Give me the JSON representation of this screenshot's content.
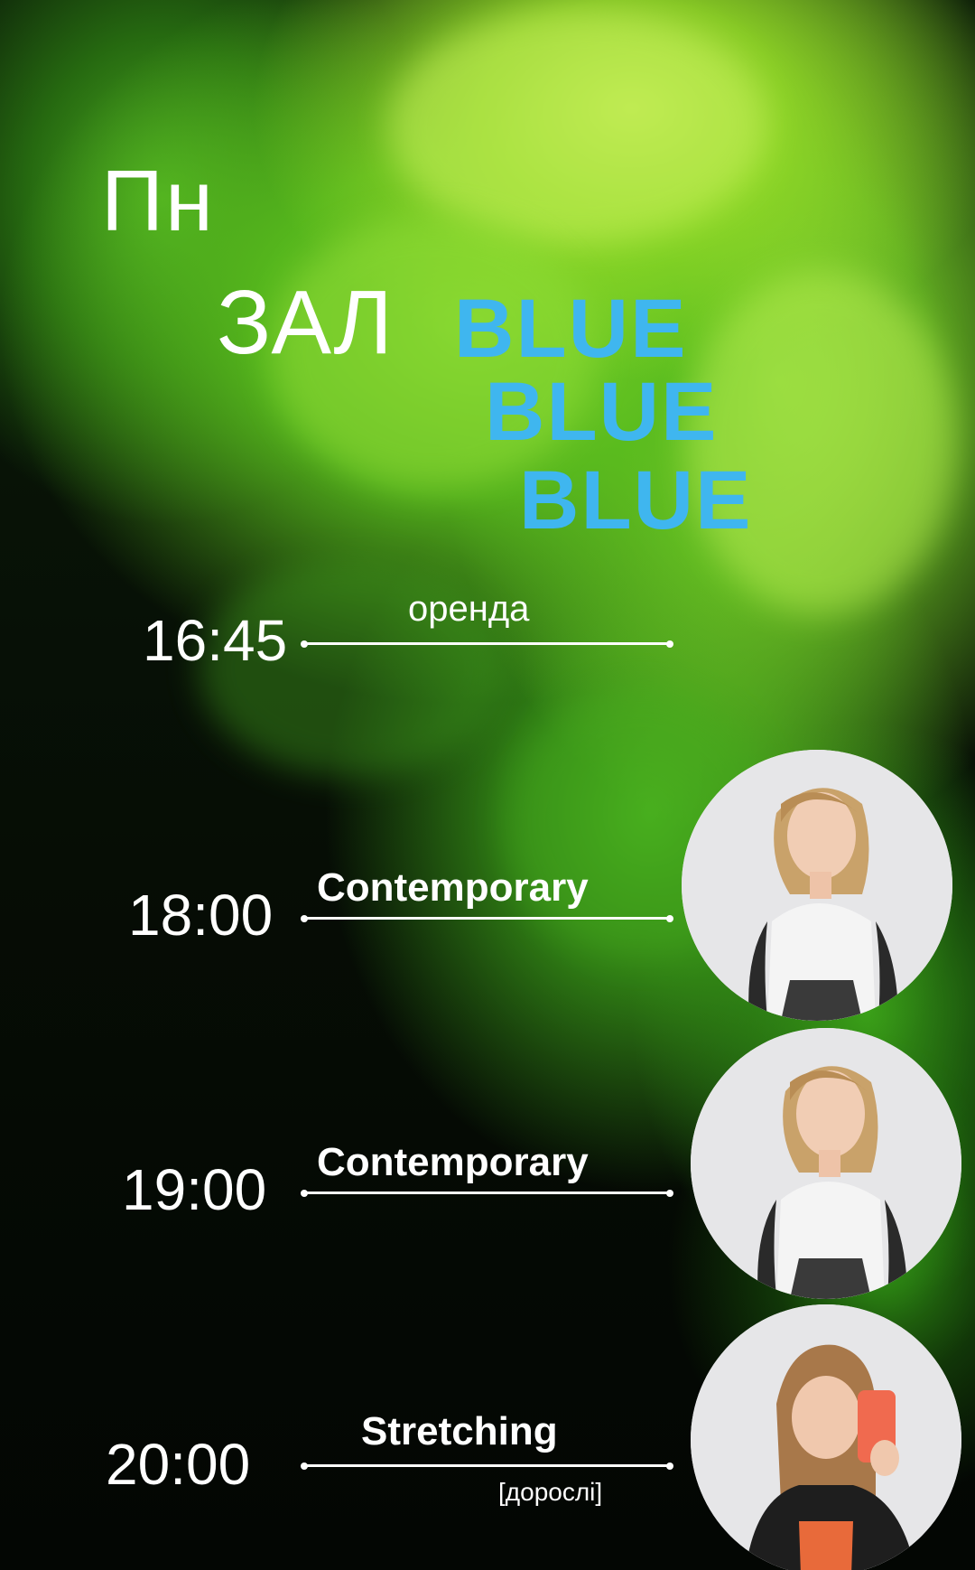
{
  "header": {
    "day": "Пн",
    "hall_label": "ЗАЛ",
    "hall_name_lines": [
      "BLUE",
      "BLUE",
      "BLUE"
    ]
  },
  "schedule": [
    {
      "time": "16:45",
      "title": "оренда",
      "note": "",
      "has_photo": false
    },
    {
      "time": "18:00",
      "title": "Contemporary",
      "note": "",
      "has_photo": true
    },
    {
      "time": "19:00",
      "title": "Contemporary",
      "note": "",
      "has_photo": true
    },
    {
      "time": "20:00",
      "title": "Stretching",
      "note": "[дорослі]",
      "has_photo": true
    }
  ],
  "colors": {
    "accent_blue": "#3fb6ef",
    "text": "#ffffff",
    "smoke_green": "#8fdc35"
  }
}
